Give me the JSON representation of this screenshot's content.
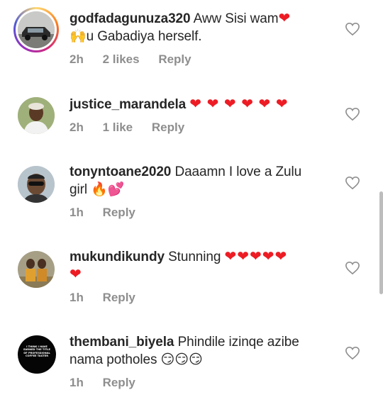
{
  "comments": [
    {
      "username": "godfadagunuza320",
      "text": " Aww Sisi wam",
      "text2": "u Gabadiya herself.",
      "time": "2h",
      "likes": "2 likes",
      "reply": "Reply"
    },
    {
      "username": "justice_marandela",
      "hearts": "❤ ❤ ❤ ❤ ❤ ❤",
      "time": "2h",
      "likes": "1 like",
      "reply": "Reply"
    },
    {
      "username": "tonyntoane2020",
      "text": " Daaamn I love a Zulu",
      "text2": "girl",
      "time": "1h",
      "reply": "Reply"
    },
    {
      "username": "mukundikundy",
      "text": " Stunning",
      "hearts": "❤❤❤❤❤",
      "hearts2": "❤",
      "time": "1h",
      "reply": "Reply"
    },
    {
      "username": "thembani_biyela",
      "text": " Phindile izinqe azibe",
      "text2": "nama potholes",
      "emoji2": "😏😏😏",
      "avatar_text": "I THINK I HAVE EARNED THE TITLE OF PROFESSIONAL COFFEE TASTER",
      "time": "1h",
      "reply": "Reply"
    }
  ],
  "icons": {
    "like": "heart-outline-icon",
    "raised_hands": "🙌",
    "fire": "🔥",
    "two_hearts": "💕"
  },
  "colors": {
    "heart": "#ed1c24",
    "meta": "#8e8e8e",
    "text": "#262626"
  }
}
